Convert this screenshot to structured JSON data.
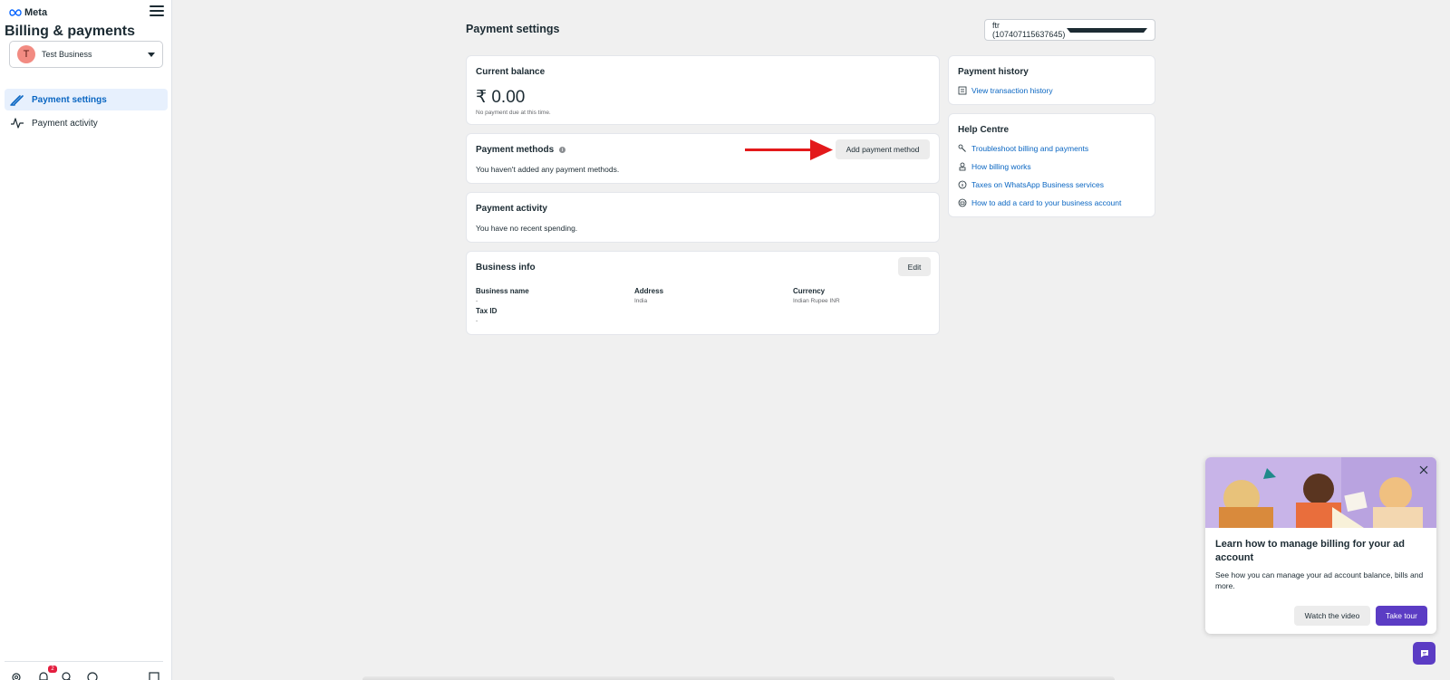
{
  "sidebar": {
    "logo_text": "Meta",
    "title": "Billing & payments",
    "business": {
      "initial": "T",
      "name": "Test Business"
    },
    "nav": [
      {
        "label": "Payment settings",
        "active": true
      },
      {
        "label": "Payment activity",
        "active": false
      }
    ],
    "notification_count": "2"
  },
  "main": {
    "page_title": "Payment settings",
    "account_select": "ftr (107407115637645)",
    "current_balance": {
      "title": "Current balance",
      "amount": "₹ 0.00",
      "note": "No payment due at this time."
    },
    "payment_methods": {
      "title": "Payment methods",
      "info_glyph": "i",
      "empty_text": "You haven't added any payment methods.",
      "add_button": "Add payment method"
    },
    "payment_activity": {
      "title": "Payment activity",
      "empty_text": "You have no recent spending."
    },
    "business_info": {
      "title": "Business info",
      "edit_button": "Edit",
      "fields": {
        "business_name": {
          "label": "Business name",
          "value": "-"
        },
        "address": {
          "label": "Address",
          "value": "India"
        },
        "currency": {
          "label": "Currency",
          "value": "Indian Rupee INR"
        },
        "tax_id": {
          "label": "Tax ID",
          "value": "-"
        }
      }
    }
  },
  "right": {
    "payment_history": {
      "title": "Payment history",
      "link": "View transaction history"
    },
    "help_centre": {
      "title": "Help Centre",
      "links": [
        "Troubleshoot billing and payments",
        "How billing works",
        "Taxes on WhatsApp Business services",
        "How to add a card to your business account"
      ]
    }
  },
  "tour": {
    "title": "Learn how to manage billing for your ad account",
    "description": "See how you can manage your ad account balance, bills and more.",
    "watch_button": "Watch the video",
    "tour_button": "Take tour"
  },
  "colors": {
    "link": "#0a66c2",
    "primary": "#5b3cc4",
    "arrow": "#e3191b",
    "active_nav_bg": "#e7f0fd"
  }
}
